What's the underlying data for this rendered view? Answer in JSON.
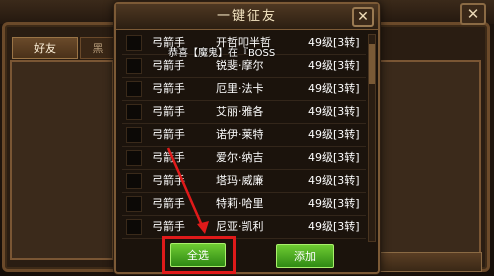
{
  "background": {
    "tab_friends": "好友",
    "tab_other": "黑"
  },
  "dialog": {
    "title": "一键征友",
    "close_glyph": "✕",
    "announcement": "恭喜【魔鬼】在『BOSS",
    "rows": [
      {
        "class": "弓箭手",
        "name": "开哲叩半哲",
        "level": "49级[3转]"
      },
      {
        "class": "弓箭手",
        "name": "锐斐·摩尔",
        "level": "49级[3转]"
      },
      {
        "class": "弓箭手",
        "name": "厄里·法卡",
        "level": "49级[3转]"
      },
      {
        "class": "弓箭手",
        "name": "艾丽·雅各",
        "level": "49级[3转]"
      },
      {
        "class": "弓箭手",
        "name": "诺伊·莱特",
        "level": "49级[3转]"
      },
      {
        "class": "弓箭手",
        "name": "爱尔·纳吉",
        "level": "49级[3转]"
      },
      {
        "class": "弓箭手",
        "name": "塔玛·威廉",
        "level": "49级[3转]"
      },
      {
        "class": "弓箭手",
        "name": "特莉·哈里",
        "level": "49级[3转]"
      },
      {
        "class": "弓箭手",
        "name": "尼亚·凯利",
        "level": "49级[3转]"
      }
    ],
    "select_all_label": "全选",
    "add_label": "添加"
  },
  "bg_close_glyph": "✕",
  "colors": {
    "highlight": "#e01a1a",
    "button_green": "#3fa41c",
    "frame_brown": "#7c5a36"
  }
}
